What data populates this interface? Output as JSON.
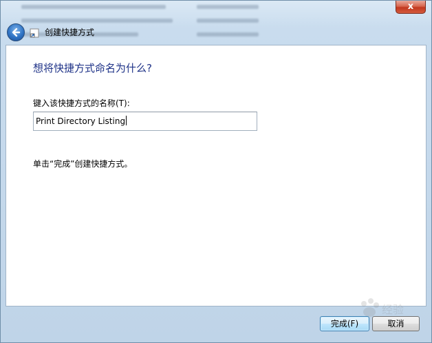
{
  "window": {
    "title": "创建快捷方式",
    "close_glyph": "x"
  },
  "page": {
    "heading": "想将快捷方式命名为什么?",
    "field_label": "键入该快捷方式的名称(T):",
    "name_value": "Print Directory Listing",
    "hint": "单击“完成”创建快捷方式。"
  },
  "buttons": {
    "finish": "完成(F)",
    "cancel": "取消"
  },
  "icons": {
    "back": "back-arrow-icon",
    "shortcut": "shortcut-icon",
    "close": "close-icon"
  },
  "colors": {
    "heading": "#1e3287",
    "accent_button": "#3c7fb1",
    "close_button": "#c2381f"
  }
}
